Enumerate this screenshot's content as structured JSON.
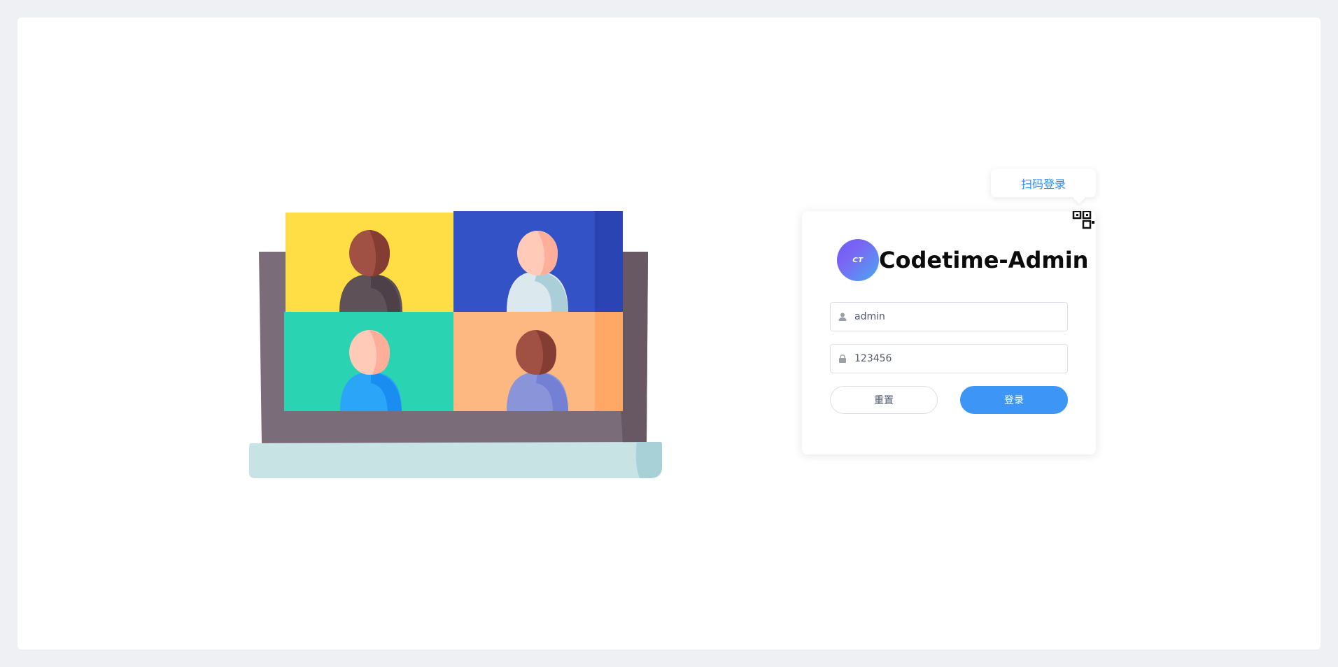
{
  "login": {
    "brand_title": "Codetime-Admin",
    "logo_text": "CT",
    "qr_login_label": "扫码登录",
    "username": {
      "value": "admin",
      "placeholder": ""
    },
    "password": {
      "value": "123456",
      "placeholder": ""
    },
    "reset_label": "重置",
    "login_label": "登录"
  },
  "icons": {
    "user": "user-icon",
    "lock": "lock-icon",
    "qr": "qr-code-icon"
  },
  "colors": {
    "accent": "#3d95f5",
    "link": "#2e8bf0",
    "background": "#eff0f4"
  }
}
